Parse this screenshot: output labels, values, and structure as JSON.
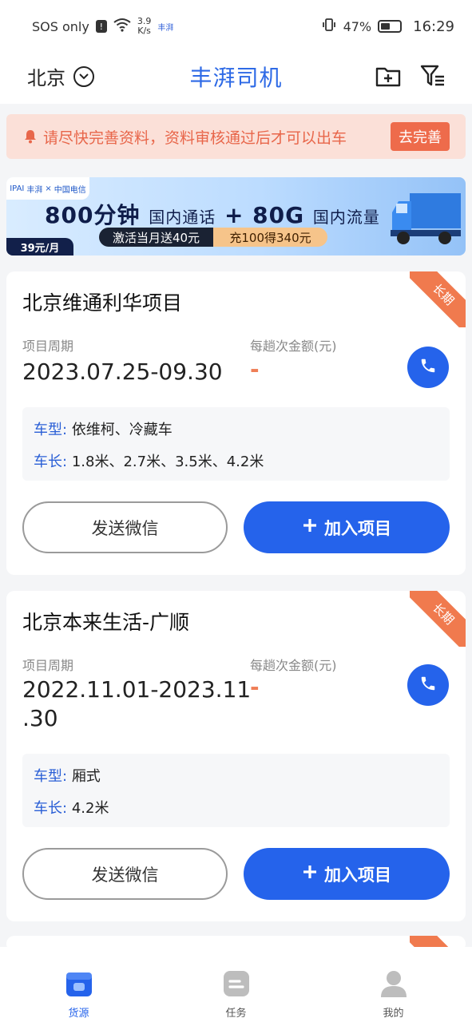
{
  "statusbar": {
    "carrier": "SOS only",
    "speed_value": "3.9",
    "speed_unit": "K/s",
    "app_icon_label": "丰湃",
    "battery": "47%",
    "time": "16:29"
  },
  "header": {
    "city": "北京",
    "title": "丰湃司机"
  },
  "notice": {
    "text": "请尽快完善资料，资料审核通过后才可以出车",
    "button": "去完善"
  },
  "banner": {
    "logo_left": "IPAI",
    "logo_left_sub": "丰湃",
    "logo_cross": "×",
    "logo_right": "中国电信",
    "main_a": "800分钟",
    "main_b": "国内通话",
    "main_c": "+ 80G",
    "main_d": "国内流量",
    "strip_left": "激活当月送40元",
    "strip_right": "充100得340元",
    "price": "39元/月"
  },
  "cards": [
    {
      "ribbon": "长期",
      "title": "北京维通利华项目",
      "period_label": "项目周期",
      "period": "2023.07.25-09.30",
      "fee_label": "每趟次金额(元)",
      "fee": "-",
      "vehicle_type_key": "车型:",
      "vehicle_type": "依维柯、冷藏车",
      "vehicle_len_key": "车长:",
      "vehicle_len": "1.8米、2.7米、3.5米、4.2米",
      "btn_wechat": "发送微信",
      "btn_join": "加入项目"
    },
    {
      "ribbon": "长期",
      "title": "北京本来生活-广顺",
      "period_label": "项目周期",
      "period_line1": "2022.11.01-2023.11",
      "period_line2": ".30",
      "fee_label": "每趟次金额(元)",
      "fee": "-",
      "vehicle_type_key": "车型:",
      "vehicle_type": "厢式",
      "vehicle_len_key": "车长:",
      "vehicle_len": "4.2米",
      "btn_wechat": "发送微信",
      "btn_join": "加入项目"
    }
  ],
  "nav": [
    {
      "label": "货源",
      "icon": "cargo-icon",
      "active": true
    },
    {
      "label": "任务",
      "icon": "task-icon",
      "active": false
    },
    {
      "label": "我的",
      "icon": "profile-icon",
      "active": false
    }
  ],
  "colors": {
    "accent": "#2563eb",
    "title_blue": "#2e6ae6",
    "warn": "#ee6b4b",
    "ribbon": "#f07a4e"
  }
}
